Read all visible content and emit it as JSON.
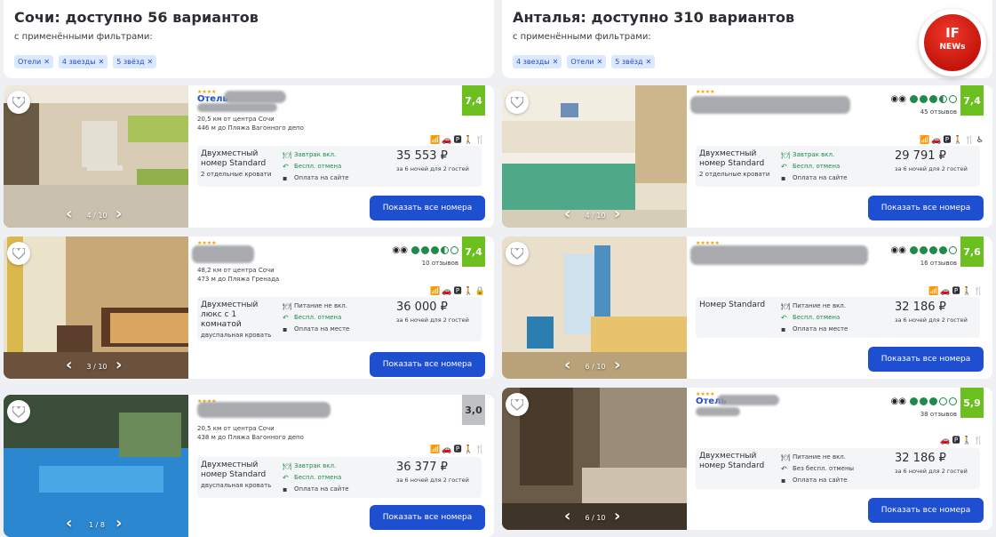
{
  "left": {
    "title": "Сочи: доступно 56 вариантов",
    "subtitle": "с применёнными фильтрами:",
    "chips": [
      "Отели",
      "4 звезды",
      "5 звёзд"
    ],
    "cards": [
      {
        "stars": "★★★★",
        "name": "Отель",
        "dist1": "20,5 км от центра Сочи",
        "dist2": "446 м до Пляжа Вагонного депо",
        "rating": "7,4",
        "amenities": "📶🚗🅿🚶🍴",
        "room_name": "Двухместный номер Standard",
        "bed": "2 отдельные кровати",
        "meal": "Завтрак вкл.",
        "cancel": "Беспл. отмена",
        "payment": "Оплата на сайте",
        "price": "35 553 ₽",
        "price_note": "за 6 ночей для 2 гостей",
        "button": "Показать все номера",
        "counter": "4 / 10"
      },
      {
        "stars": "★★★★",
        "name": "",
        "reviews": "10 отзывов",
        "dist1": "48,2 км от центра Сочи",
        "dist2": "473 м до Пляжа Гренада",
        "rating": "7,4",
        "amenities": "📶🚗🅿🚶🔒",
        "room_name": "Двухместный люкс с 1 комнатой",
        "bed": "двуспальная кровать",
        "meal": "Питание не вкл.",
        "cancel": "Беспл. отмена",
        "payment": "Оплата на месте",
        "price": "36 000 ₽",
        "price_note": "за 6 ночей для 2 гостей",
        "button": "Показать все номера",
        "counter": "3 / 10"
      },
      {
        "stars": "★★★★",
        "name": "",
        "dist1": "20,5 км от центра Сочи",
        "dist2": "438 м до Пляжа Вагонного депо",
        "rating": "3,0",
        "amenities": "📶🚗🅿🚶🍴",
        "room_name": "Двухместный номер Standard",
        "bed": "двуспальная кровать",
        "meal": "Завтрак вкл.",
        "cancel": "Беспл. отмена",
        "payment": "Оплата на сайте",
        "price": "36 377 ₽",
        "price_note": "за 6 ночей для 2 гостей",
        "button": "Показать все номера",
        "counter": "1 / 8"
      }
    ]
  },
  "right": {
    "title": "Анталья: доступно 310 вариантов",
    "subtitle": "с применёнными фильтрами:",
    "chips": [
      "4 звезды",
      "Отели",
      "5 звёзд"
    ],
    "cards": [
      {
        "stars": "★★★★",
        "name": "",
        "reviews": "45 отзывов",
        "rating": "7,4",
        "amenities": "📶🚗🅿🚶🍴♿",
        "room_name": "Двухместный номер Standard",
        "bed": "2 отдельные кровати",
        "meal": "Завтрак вкл.",
        "cancel": "Беспл. отмена",
        "payment": "Оплата на сайте",
        "price": "29 791 ₽",
        "price_note": "за 6 ночей для 2 гостей",
        "button": "Показать все номера",
        "counter": "4 / 10"
      },
      {
        "stars": "★★★★★",
        "name": "",
        "reviews": "16 отзывов",
        "rating": "7,6",
        "amenities": "📶🚗🅿🚶🍴",
        "room_name": "Номер Standard",
        "bed": "",
        "meal": "Питание не вкл.",
        "cancel": "Беспл. отмена",
        "payment": "Оплата на месте",
        "price": "32 186 ₽",
        "price_note": "за 6 ночей для 2 гостей",
        "button": "Показать все номера",
        "counter": "6 / 10"
      },
      {
        "stars": "★★★★",
        "name": "Отель",
        "reviews": "38 отзывов",
        "rating": "5,9",
        "amenities": "🚗🅿🚶🍴",
        "room_name": "Двухместный номер Standard",
        "bed": "",
        "meal": "Питание не вкл.",
        "cancel": "Без беспл. отмены",
        "payment": "Оплата на сайте",
        "price": "32 186 ₽",
        "price_note": "за 6 ночей для 2 гостей",
        "button": "Показать все номера",
        "counter": "6 / 10"
      }
    ]
  },
  "logo": {
    "line1": "IF",
    "line2": "NEWs"
  },
  "colors": {
    "accent": "#1f4fd1",
    "rating_green": "#6bbf1e",
    "rating_grey": "#bfc1c5",
    "tripadvisor": "#1e8b4a"
  }
}
